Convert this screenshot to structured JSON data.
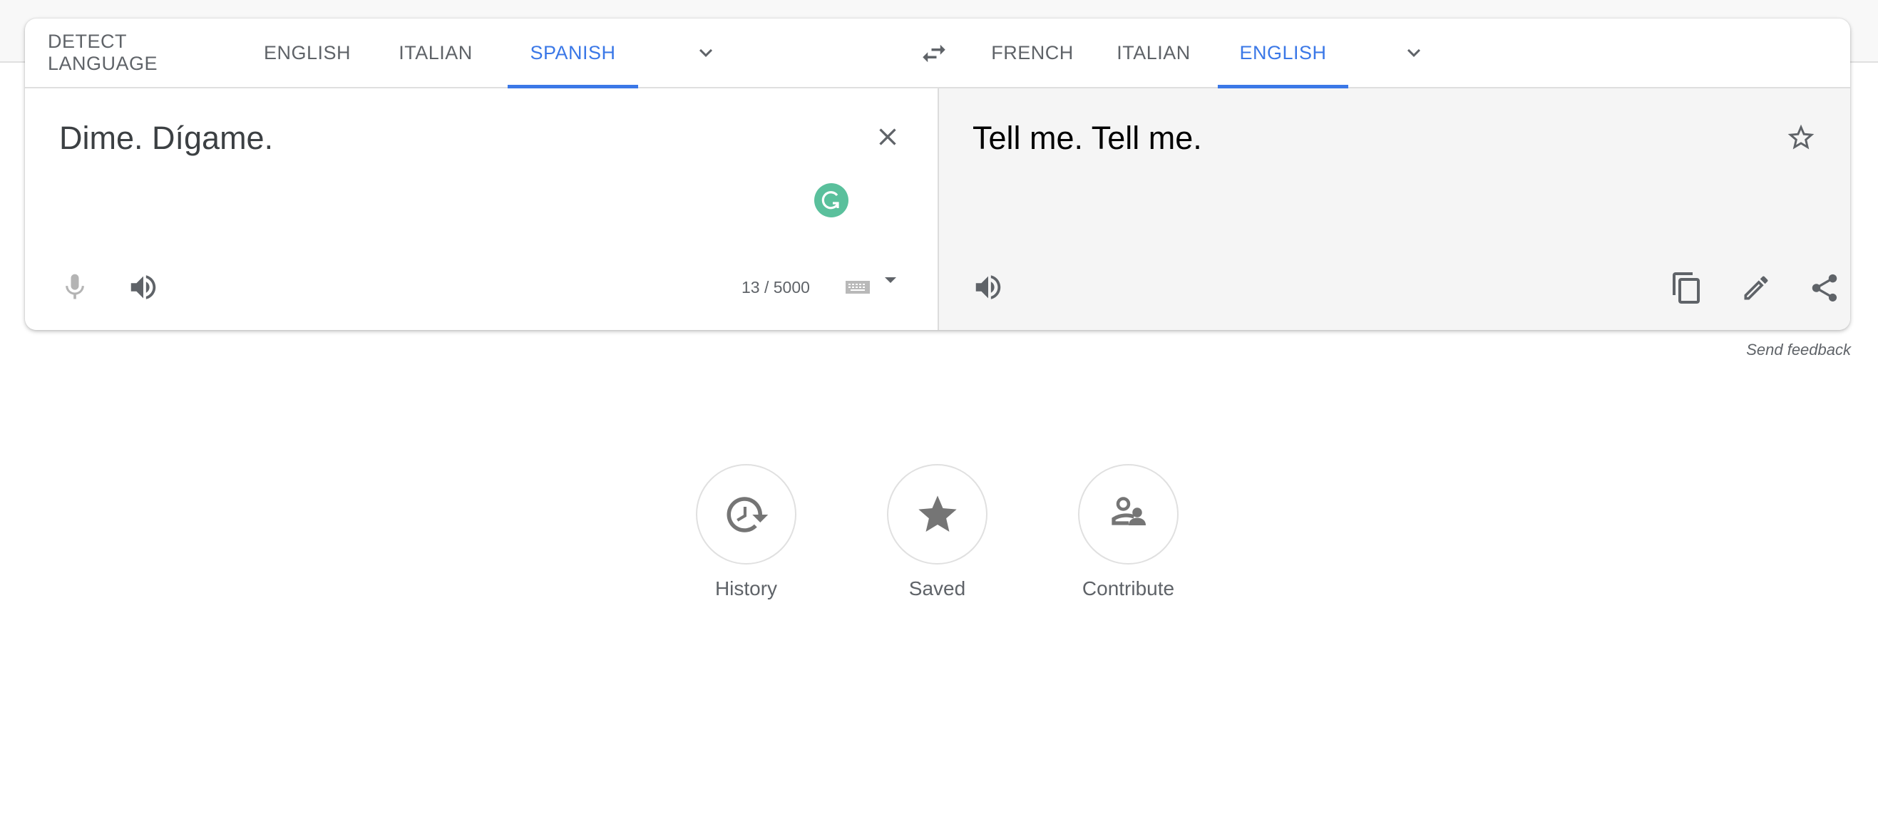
{
  "source_languages": {
    "tabs": [
      {
        "label": "DETECT LANGUAGE",
        "active": false
      },
      {
        "label": "ENGLISH",
        "active": false
      },
      {
        "label": "ITALIAN",
        "active": false
      },
      {
        "label": "SPANISH",
        "active": true
      }
    ],
    "more_icon": "chevron-down-icon"
  },
  "swap_icon": "swap-arrows-icon",
  "target_languages": {
    "tabs": [
      {
        "label": "FRENCH",
        "active": false
      },
      {
        "label": "ITALIAN",
        "active": false
      },
      {
        "label": "ENGLISH",
        "active": true
      }
    ],
    "more_icon": "chevron-down-icon"
  },
  "source": {
    "text": "Dime. Dígame.",
    "char_count": "13 / 5000",
    "icons": [
      "close-icon",
      "grammarly-icon",
      "microphone-icon",
      "speaker-icon",
      "keyboard-icon",
      "caret-down-icon"
    ]
  },
  "target": {
    "text": "Tell me. Tell me.",
    "icons": [
      "star-outline-icon",
      "speaker-icon",
      "copy-icon",
      "edit-icon",
      "share-icon"
    ]
  },
  "feedback_label": "Send feedback",
  "shortcuts": [
    {
      "label": "History",
      "icon": "history-icon"
    },
    {
      "label": "Saved",
      "icon": "star-icon"
    },
    {
      "label": "Contribute",
      "icon": "contribute-icon"
    }
  ],
  "colors": {
    "accent": "#3b78e7",
    "icon_gray": "#5f6368",
    "grammarly_green": "#5ac09c",
    "target_bg": "#f5f5f5"
  }
}
